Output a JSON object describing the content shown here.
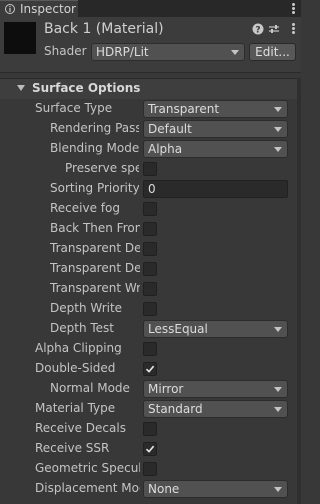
{
  "tab": {
    "label": "Inspector"
  },
  "header": {
    "title": "Back 1 (Material)",
    "shader_label": "Shader",
    "shader_value": "HDRP/Lit",
    "edit_label": "Edit..."
  },
  "section": {
    "title": "Surface Options"
  },
  "rows": [
    {
      "label": "Surface Type",
      "control": "dropdown",
      "value": "Transparent"
    },
    {
      "label": "Rendering Pass",
      "control": "dropdown",
      "value": "Default"
    },
    {
      "label": "Blending Mode",
      "control": "dropdown",
      "value": "Alpha"
    },
    {
      "label": "Preserve specular lighting",
      "control": "checkbox",
      "checked": false
    },
    {
      "label": "Sorting Priority",
      "control": "number",
      "value": "0"
    },
    {
      "label": "Receive fog",
      "control": "checkbox",
      "checked": false
    },
    {
      "label": "Back Then Front Rendering",
      "control": "checkbox",
      "checked": false
    },
    {
      "label": "Transparent Depth Prepass",
      "control": "checkbox",
      "checked": false
    },
    {
      "label": "Transparent Depth Postpass",
      "control": "checkbox",
      "checked": false
    },
    {
      "label": "Transparent Writes Motion Vectors",
      "control": "checkbox",
      "checked": false
    },
    {
      "label": "Depth Write",
      "control": "checkbox",
      "checked": false
    },
    {
      "label": "Depth Test",
      "control": "dropdown",
      "value": "LessEqual"
    },
    {
      "label": "Alpha Clipping",
      "control": "checkbox",
      "checked": false
    },
    {
      "label": "Double-Sided",
      "control": "checkbox",
      "checked": true
    },
    {
      "label": "Normal Mode",
      "control": "dropdown",
      "value": "Mirror"
    },
    {
      "label": "Material Type",
      "control": "dropdown",
      "value": "Standard"
    },
    {
      "label": "Receive Decals",
      "control": "checkbox",
      "checked": false
    },
    {
      "label": "Receive SSR",
      "control": "checkbox",
      "checked": true
    },
    {
      "label": "Geometric Specular AA",
      "control": "checkbox",
      "checked": false
    },
    {
      "label": "Displacement Mode",
      "control": "dropdown",
      "value": "None"
    }
  ],
  "icons": {
    "tab": "inspector-info-icon",
    "help": "help-icon",
    "presets": "presets-icon",
    "menu": "more-menu-icon",
    "foldout": "foldout-arrow-icon"
  }
}
